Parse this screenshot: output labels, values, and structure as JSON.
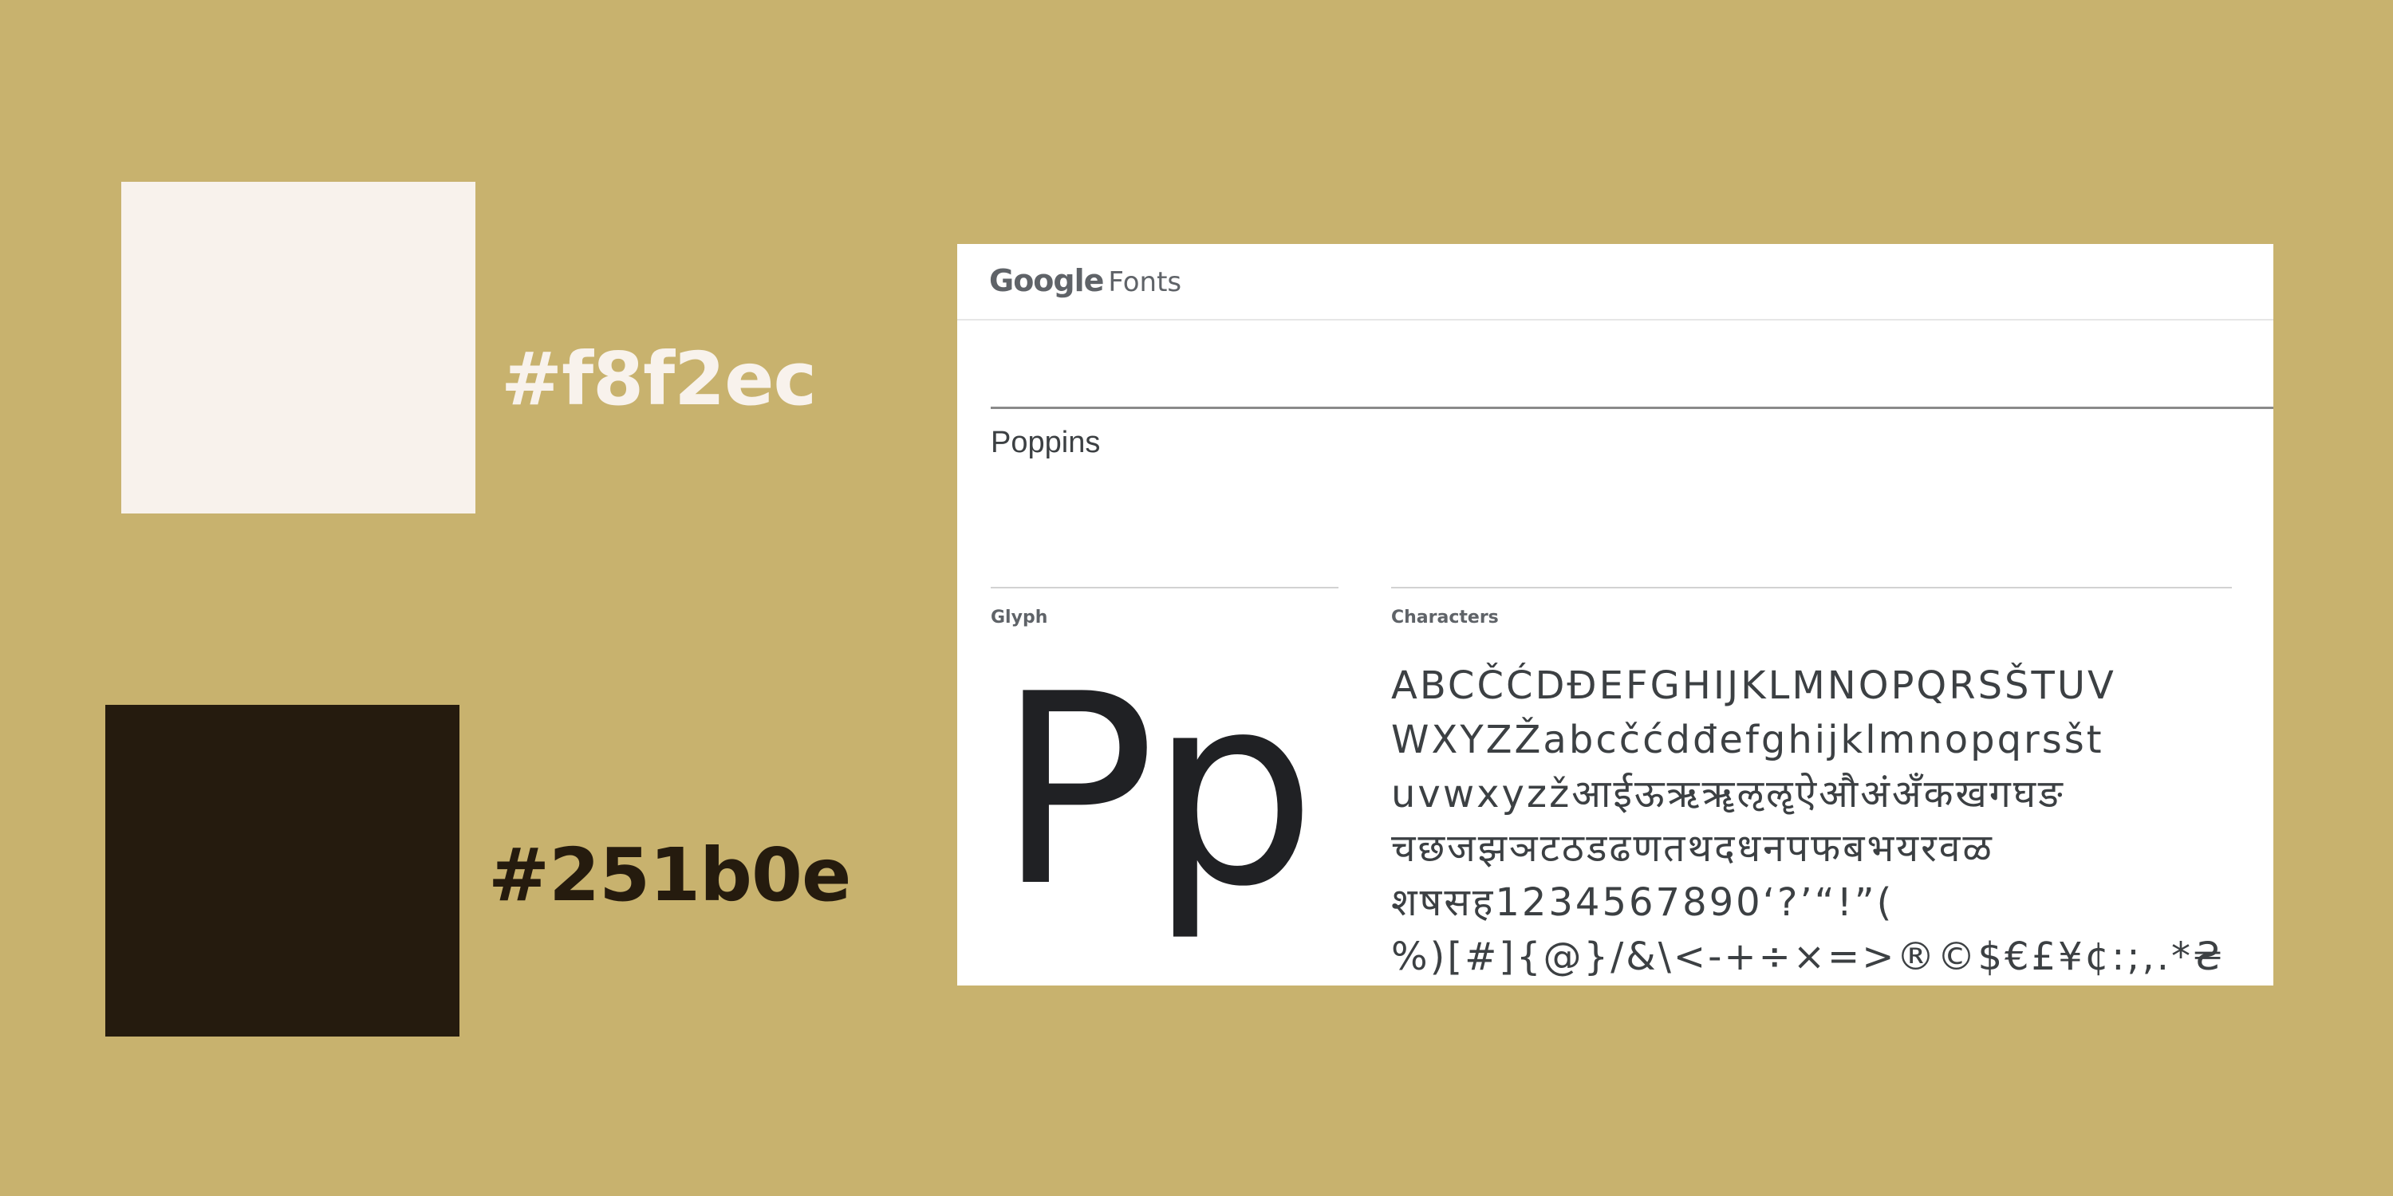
{
  "swatches": [
    {
      "hex_label": "#f8f2ec",
      "color": "#f8f2ec"
    },
    {
      "hex_label": "#251b0e",
      "color": "#251b0e"
    }
  ],
  "colors": {
    "background": "#c8b26e",
    "panel": "#ffffff",
    "text": "#3c4043"
  },
  "google_fonts": {
    "logo_google": "Google",
    "logo_fonts": "Fonts",
    "font_name": "Poppins",
    "glyph_label": "Glyph",
    "glyph": "Pp",
    "characters_label": "Characters",
    "characters_lines": [
      "ABCČĆDĐEFGHIJKLMNOPQRSŠTUV",
      "WXYZŽabcčćdđefghijklmnopqrsšt",
      "uvwxyzžआईऊऋॠऌॡऐऔअंअँकखगघङ",
      "चछजझञटठडढणतथदधनपफबभयरवळ",
      "शषसह1234567890‘?’“!”(",
      "%)[#]{@}/&\\<-+÷×=>®©$€£¥¢:;,.*₴"
    ]
  }
}
